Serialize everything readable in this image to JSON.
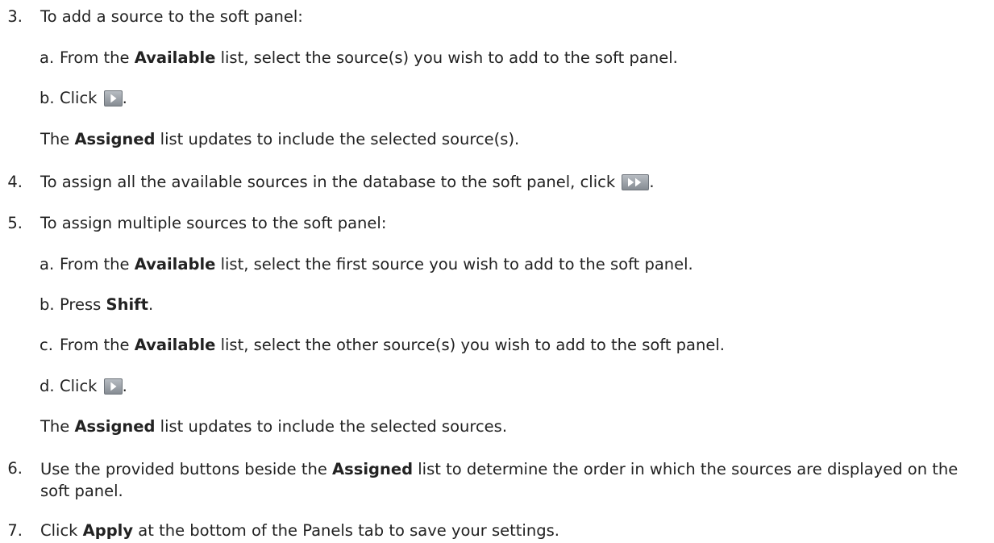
{
  "steps": [
    {
      "number": "3.",
      "text": "To add a source to the soft panel:",
      "substeps": [
        {
          "letter": "a.",
          "pre": "From the ",
          "bold": "Available",
          "post": " list, select the source(s) you wish to add to the soft panel."
        },
        {
          "letter": "b.",
          "pre": "Click ",
          "icon": "play-right-icon",
          "post": "."
        }
      ],
      "note": {
        "pre": "The ",
        "bold": "Assigned",
        "post": " list updates to include the selected source(s)."
      }
    },
    {
      "number": "4.",
      "pre": "To assign all the available sources in the database to the soft panel, click ",
      "icon": "double-right-icon",
      "post": "."
    },
    {
      "number": "5.",
      "text": "To assign multiple sources to the soft panel:",
      "substeps": [
        {
          "letter": "a.",
          "pre": "From the ",
          "bold": "Available",
          "post": " list, select the first source you wish to add to the soft panel."
        },
        {
          "letter": "b.",
          "pre": "Press ",
          "bold": "Shift",
          "post": "."
        },
        {
          "letter": "c.",
          "pre": "From the ",
          "bold": "Available",
          "post": " list, select the other source(s) you wish to add to the soft panel."
        },
        {
          "letter": "d.",
          "pre": "Click ",
          "icon": "play-right-icon",
          "post": "."
        }
      ],
      "note": {
        "pre": "The ",
        "bold": "Assigned",
        "post": " list updates to include the selected sources."
      }
    },
    {
      "number": "6.",
      "pre": "Use the provided buttons beside the ",
      "bold": "Assigned",
      "post": " list to determine the order in which the sources are displayed on the soft panel."
    },
    {
      "number": "7.",
      "pre": "Click ",
      "bold": "Apply",
      "post": " at the bottom of the Panels tab to save your settings."
    }
  ],
  "colors": {
    "text": "#222222",
    "icon_fill": "#ffffff",
    "icon_bg": "#9aa0a6"
  }
}
